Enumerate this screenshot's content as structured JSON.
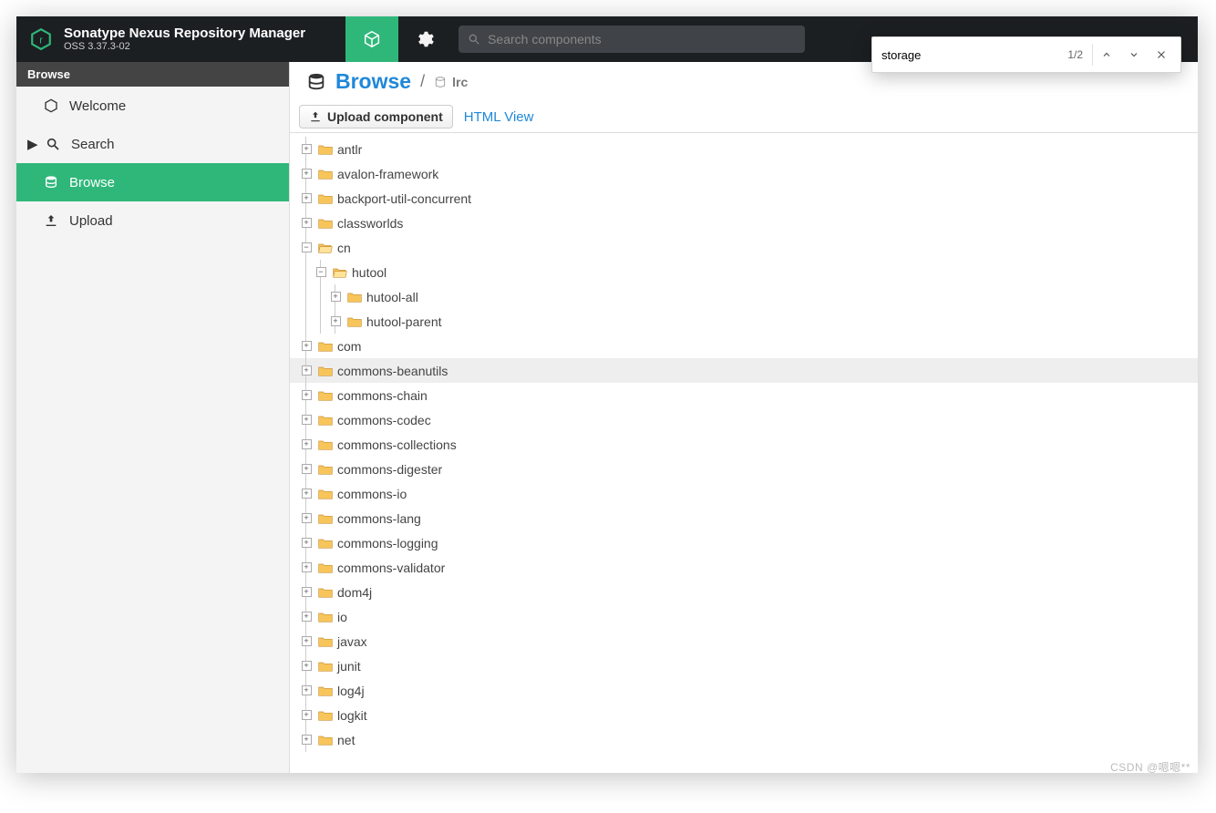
{
  "header": {
    "title": "Sonatype Nexus Repository Manager",
    "version": "OSS 3.37.3-02",
    "search_placeholder": "Search components"
  },
  "find": {
    "query": "storage",
    "count": "1/2"
  },
  "sidebar": {
    "title": "Browse",
    "items": [
      {
        "label": "Welcome",
        "icon": "hex"
      },
      {
        "label": "Search",
        "icon": "magnify",
        "expandable": true
      },
      {
        "label": "Browse",
        "icon": "db",
        "active": true
      },
      {
        "label": "Upload",
        "icon": "upload"
      }
    ]
  },
  "breadcrumb": {
    "section": "Browse",
    "repo": "lrc"
  },
  "toolbar": {
    "upload_label": "Upload component",
    "html_view_label": "HTML View"
  },
  "tree": [
    {
      "depth": 0,
      "state": "plus",
      "name": "antlr"
    },
    {
      "depth": 0,
      "state": "plus",
      "name": "avalon-framework"
    },
    {
      "depth": 0,
      "state": "plus",
      "name": "backport-util-concurrent"
    },
    {
      "depth": 0,
      "state": "plus",
      "name": "classworlds"
    },
    {
      "depth": 0,
      "state": "minus",
      "name": "cn",
      "open": true
    },
    {
      "depth": 1,
      "state": "minus",
      "name": "hutool",
      "open": true
    },
    {
      "depth": 2,
      "state": "plus",
      "name": "hutool-all"
    },
    {
      "depth": 2,
      "state": "plus",
      "name": "hutool-parent"
    },
    {
      "depth": 0,
      "state": "plus",
      "name": "com"
    },
    {
      "depth": 0,
      "state": "plus",
      "name": "commons-beanutils",
      "hover": true
    },
    {
      "depth": 0,
      "state": "plus",
      "name": "commons-chain"
    },
    {
      "depth": 0,
      "state": "plus",
      "name": "commons-codec"
    },
    {
      "depth": 0,
      "state": "plus",
      "name": "commons-collections"
    },
    {
      "depth": 0,
      "state": "plus",
      "name": "commons-digester"
    },
    {
      "depth": 0,
      "state": "plus",
      "name": "commons-io"
    },
    {
      "depth": 0,
      "state": "plus",
      "name": "commons-lang"
    },
    {
      "depth": 0,
      "state": "plus",
      "name": "commons-logging"
    },
    {
      "depth": 0,
      "state": "plus",
      "name": "commons-validator"
    },
    {
      "depth": 0,
      "state": "plus",
      "name": "dom4j"
    },
    {
      "depth": 0,
      "state": "plus",
      "name": "io"
    },
    {
      "depth": 0,
      "state": "plus",
      "name": "javax"
    },
    {
      "depth": 0,
      "state": "plus",
      "name": "junit"
    },
    {
      "depth": 0,
      "state": "plus",
      "name": "log4j"
    },
    {
      "depth": 0,
      "state": "plus",
      "name": "logkit"
    },
    {
      "depth": 0,
      "state": "plus",
      "name": "net"
    }
  ],
  "watermark": "CSDN @嗯嗯**"
}
